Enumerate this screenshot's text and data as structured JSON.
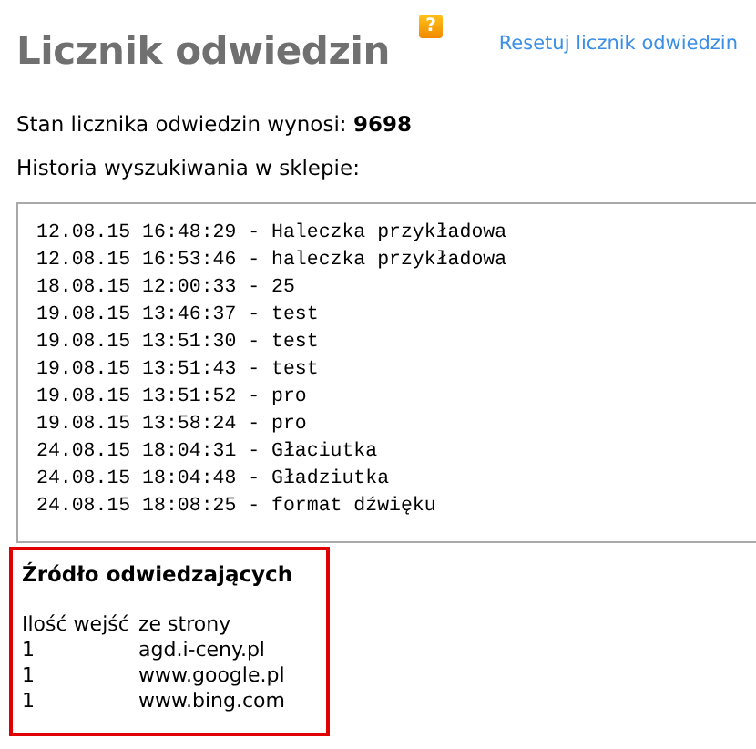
{
  "title": "Licznik odwiedzin",
  "help_icon": "?",
  "reset_link": "Resetuj licznik odwiedzin",
  "counter": {
    "label": "Stan licznika odwiedzin wynosi:",
    "value": "9698"
  },
  "history": {
    "label": "Historia wyszukiwania w sklepie:",
    "entries": [
      "12.08.15 16:48:29 - Haleczka przykładowa",
      "12.08.15 16:53:46 - haleczka przykładowa",
      "18.08.15 12:00:33 - 25",
      "19.08.15 13:46:37 - test",
      "19.08.15 13:51:30 - test",
      "19.08.15 13:51:43 - test",
      "19.08.15 13:51:52 - pro",
      "19.08.15 13:58:24 - pro",
      "24.08.15 18:04:31 - Głaciutka",
      "24.08.15 18:04:48 - Gładziutka",
      "24.08.15 18:08:25 - format dźwięku"
    ]
  },
  "sources": {
    "title": "Źródło odwiedzających",
    "columns": [
      "Ilość wejść",
      "ze strony"
    ],
    "rows": [
      [
        "1",
        "agd.i-ceny.pl"
      ],
      [
        "1",
        "www.google.pl"
      ],
      [
        "1",
        "www.bing.com"
      ]
    ]
  }
}
